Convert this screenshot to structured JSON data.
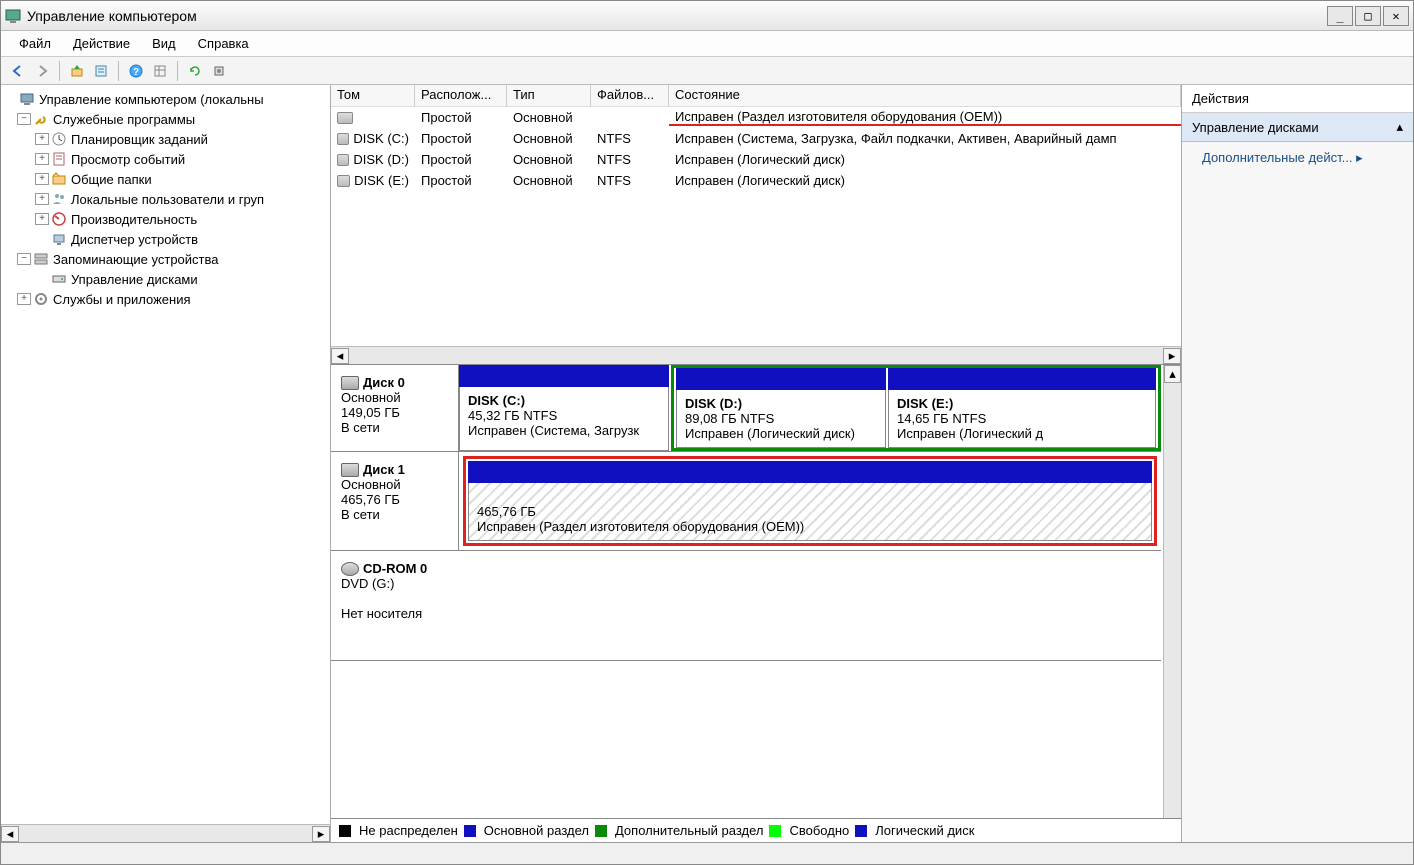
{
  "window": {
    "title": "Управление компьютером"
  },
  "menu": {
    "file": "Файл",
    "action": "Действие",
    "view": "Вид",
    "help": "Справка"
  },
  "tree": {
    "root": "Управление компьютером (локальны",
    "utilities": "Служебные программы",
    "scheduler": "Планировщик заданий",
    "eventviewer": "Просмотр событий",
    "sharedfolders": "Общие папки",
    "localusers": "Локальные пользователи и груп",
    "performance": "Производительность",
    "devicemgr": "Диспетчер устройств",
    "storage": "Запоминающие устройства",
    "diskmgmt": "Управление дисками",
    "services": "Службы и приложения"
  },
  "vol_headers": {
    "c0": "Том",
    "c1": "Располож...",
    "c2": "Тип",
    "c3": "Файлов...",
    "c4": "Состояние"
  },
  "volumes": [
    {
      "name": "",
      "layout": "Простой",
      "type": "Основной",
      "fs": "",
      "status": "Исправен (Раздел изготовителя оборудования (OEM))",
      "hl": true
    },
    {
      "name": "DISK (C:)",
      "layout": "Простой",
      "type": "Основной",
      "fs": "NTFS",
      "status": "Исправен (Система, Загрузка, Файл подкачки, Активен, Аварийный дамп"
    },
    {
      "name": "DISK (D:)",
      "layout": "Простой",
      "type": "Основной",
      "fs": "NTFS",
      "status": "Исправен (Логический диск)"
    },
    {
      "name": "DISK (E:)",
      "layout": "Простой",
      "type": "Основной",
      "fs": "NTFS",
      "status": "Исправен (Логический диск)"
    }
  ],
  "disks": {
    "d0": {
      "name": "Диск 0",
      "type": "Основной",
      "size": "149,05 ГБ",
      "online": "В сети",
      "p0": {
        "title": "DISK  (C:)",
        "size": "45,32 ГБ NTFS",
        "status": "Исправен (Система, Загрузк"
      },
      "p1": {
        "title": "DISK  (D:)",
        "size": "89,08 ГБ NTFS",
        "status": "Исправен (Логический диск)"
      },
      "p2": {
        "title": "DISK  (E:)",
        "size": "14,65 ГБ NTFS",
        "status": "Исправен (Логический д"
      }
    },
    "d1": {
      "name": "Диск 1",
      "type": "Основной",
      "size": "465,76 ГБ",
      "online": "В сети",
      "p0": {
        "title": "",
        "size": "465,76 ГБ",
        "status": "Исправен (Раздел изготовителя оборудования (OEM))"
      }
    },
    "cd": {
      "name": "CD-ROM 0",
      "type": "DVD (G:)",
      "nomedia": "Нет носителя"
    }
  },
  "legend": {
    "unalloc": "Не распределен",
    "primary": "Основной раздел",
    "extended": "Дополнительный раздел",
    "free": "Свободно",
    "logical": "Логический диск"
  },
  "actions": {
    "header": "Действия",
    "section": "Управление дисками",
    "more": "Дополнительные дейст..."
  }
}
